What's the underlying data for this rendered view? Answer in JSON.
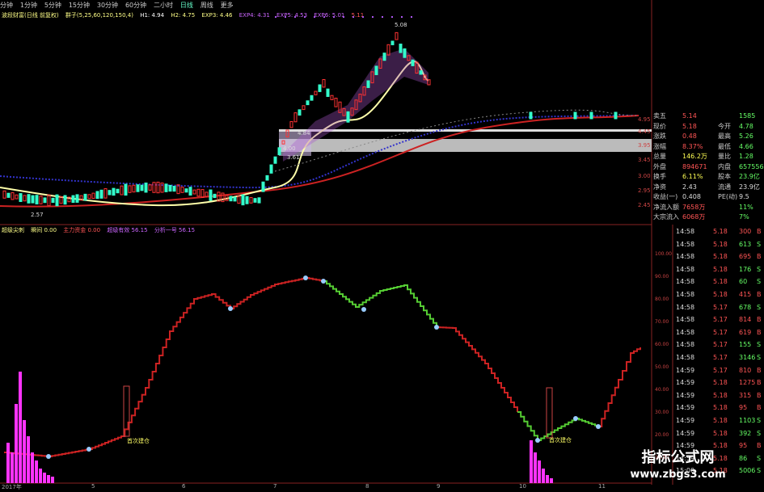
{
  "toolbar": {
    "items": [
      "分钟",
      "1分钟",
      "5分钟",
      "15分钟",
      "30分钟",
      "60分钟",
      "二小时",
      "日线",
      "周线",
      "更多"
    ],
    "active_index": 7
  },
  "legend_top": {
    "label": "波段财富(日线 前复权)",
    "params": "群子(5,25,60,120,150,4)",
    "h1": "H1: 4.94",
    "h2": "H2: 4.75",
    "ex1": "EXP3: 4.46",
    "ex2": "EXP4: 4.31",
    "ex3": "EXP5: 4.53",
    "ex4": "EXP6: 5.01",
    "ex5": "5.11"
  },
  "legend_bot": {
    "label": "超级尖刺",
    "v1": "瞬间 0.00",
    "v2": "主力资金 0.00",
    "v3": "超级有效 56.15",
    "v4": "分析一号 56.15"
  },
  "price_axis": [
    "4.95",
    "4.45",
    "3.95",
    "3.45",
    "3.00",
    "2.95",
    "2.45"
  ],
  "osc_axis": [
    "100.00",
    "90.00",
    "80.00",
    "70.00",
    "60.00",
    "50.00",
    "40.00",
    "30.00",
    "20.00",
    "10.00"
  ],
  "annotations": {
    "low_label": "2.57",
    "mid_label1": "4.84",
    "mid_label2": "4.00",
    "mid_label3": "3.61",
    "high_label": "5.08",
    "buy1": "首次建仓",
    "buy2": "首次建仓"
  },
  "x_axis_labels": [
    "2017年",
    "5",
    "6",
    "7",
    "8",
    "9",
    "10",
    "11"
  ],
  "quote": {
    "rows": [
      {
        "k": "卖五",
        "v": "5.14",
        "k2": "",
        "v2": "1585",
        "c": "#f55"
      },
      {
        "k": "现价",
        "v": "5.18",
        "k2": "今开",
        "v2": "4.78",
        "c": "#f55"
      },
      {
        "k": "涨跌",
        "v": "0.48",
        "k2": "最高",
        "v2": "5.26",
        "c": "#f55"
      },
      {
        "k": "涨幅",
        "v": "8.37%",
        "k2": "最低",
        "v2": "4.66",
        "c": "#f55"
      },
      {
        "k": "总量",
        "v": "146.2万",
        "k2": "量比",
        "v2": "1.28",
        "c": "#ff5"
      },
      {
        "k": "外盘",
        "v": "894671",
        "k2": "内盘",
        "v2": "657556",
        "c": "#f55"
      },
      {
        "k": "换手",
        "v": "6.11%",
        "k2": "股本",
        "v2": "23.9亿",
        "c": "#ff5"
      },
      {
        "k": "净资",
        "v": "2.43",
        "k2": "流通",
        "v2": "23.9亿",
        "c": "#ddd"
      },
      {
        "k": "收益(一)",
        "v": "0.408",
        "k2": "PE(动)",
        "v2": "9.5",
        "c": "#ddd"
      },
      {
        "k": "净流入额",
        "v": "7658万",
        "k2": "",
        "v2": "11%",
        "c": "#f55"
      },
      {
        "k": "大宗流入",
        "v": "6068万",
        "k2": "",
        "v2": "7%",
        "c": "#f55"
      }
    ]
  },
  "ticks": [
    {
      "t": "14:58",
      "p": "5.18",
      "v": "300",
      "d": "B"
    },
    {
      "t": "14:58",
      "p": "5.18",
      "v": "613",
      "d": "S"
    },
    {
      "t": "14:58",
      "p": "5.18",
      "v": "695",
      "d": "B"
    },
    {
      "t": "14:58",
      "p": "5.18",
      "v": "176",
      "d": "S"
    },
    {
      "t": "14:58",
      "p": "5.18",
      "v": "60",
      "d": "S"
    },
    {
      "t": "14:58",
      "p": "5.18",
      "v": "415",
      "d": "B"
    },
    {
      "t": "14:58",
      "p": "5.17",
      "v": "678",
      "d": "S"
    },
    {
      "t": "14:58",
      "p": "5.17",
      "v": "814",
      "d": "B"
    },
    {
      "t": "14:58",
      "p": "5.17",
      "v": "619",
      "d": "B"
    },
    {
      "t": "14:58",
      "p": "5.17",
      "v": "155",
      "d": "S"
    },
    {
      "t": "14:58",
      "p": "5.17",
      "v": "3146",
      "d": "S"
    },
    {
      "t": "14:59",
      "p": "5.17",
      "v": "810",
      "d": "B"
    },
    {
      "t": "14:59",
      "p": "5.18",
      "v": "1275",
      "d": "B"
    },
    {
      "t": "14:59",
      "p": "5.18",
      "v": "315",
      "d": "B"
    },
    {
      "t": "14:59",
      "p": "5.18",
      "v": "95",
      "d": "B"
    },
    {
      "t": "14:59",
      "p": "5.18",
      "v": "1103",
      "d": "S"
    },
    {
      "t": "14:59",
      "p": "5.18",
      "v": "392",
      "d": "S"
    },
    {
      "t": "14:59",
      "p": "5.18",
      "v": "95",
      "d": "B"
    },
    {
      "t": "14:59",
      "p": "5.18",
      "v": "86",
      "d": "S"
    },
    {
      "t": "15:00",
      "p": "5.18",
      "v": "5006",
      "d": "S"
    }
  ],
  "watermark": {
    "line1": "指标公式网",
    "line2": "www.zbgs3.com"
  },
  "colors": {
    "up": "#ff3333",
    "down": "#33ffcc",
    "ma_yellow": "#ffffaa",
    "ma_red": "#cc2222",
    "ma_blue": "#3333cc",
    "osc_red": "#cc2222",
    "osc_green": "#55cc33",
    "magenta": "#ff33ff"
  }
}
